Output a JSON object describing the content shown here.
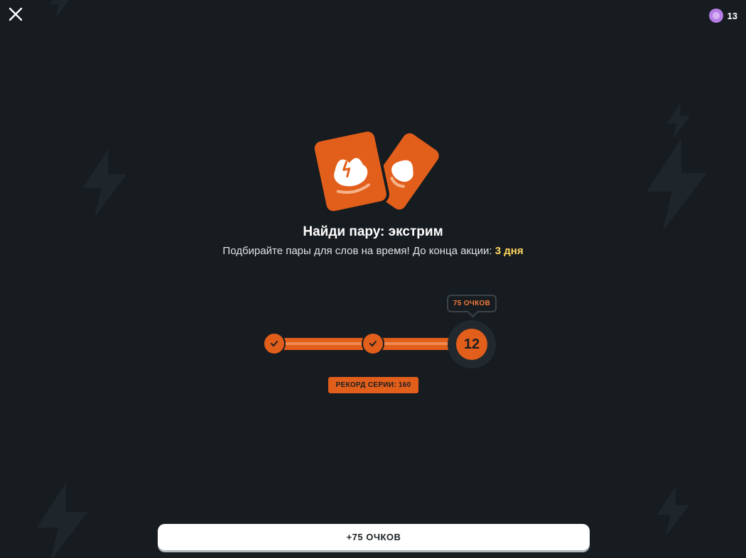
{
  "header": {
    "close_icon": "close-icon",
    "gems_icon": "gem-icon",
    "gems_count": "13"
  },
  "hero": {
    "icon": "cards-icon",
    "title": "Найди пару: экстрим",
    "subtitle_prefix": "Подбирайте пары для слов на время! До конца акции: ",
    "subtitle_highlight": "3 дня"
  },
  "progress": {
    "completed_steps": 2,
    "current_step": "12",
    "reward_tooltip": "75 ОЧКОВ",
    "record_label": "РЕКОРД СЕРИИ: 160"
  },
  "cta": {
    "label": "+75 ОЧКОВ"
  },
  "colors": {
    "background": "#171c20",
    "accent": "#e25e1b",
    "highlight": "#ffd85e"
  }
}
